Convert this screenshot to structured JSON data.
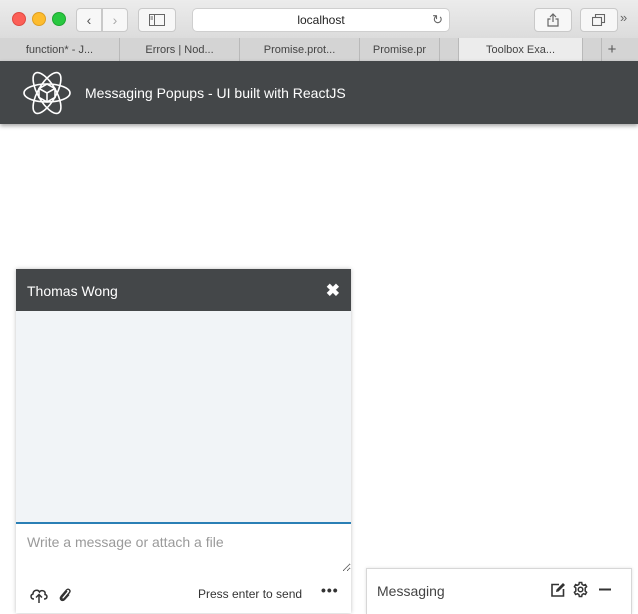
{
  "browser": {
    "url": "localhost",
    "tabs": [
      {
        "label": "function* - J..."
      },
      {
        "label": "Errors | Nod..."
      },
      {
        "label": "Promise.prot..."
      },
      {
        "label": "Promise.pr"
      },
      {
        "label": "Toolbox Exa..."
      }
    ],
    "nav": {
      "back": "‹",
      "forward": "›",
      "reload": "↻",
      "more": "»",
      "add_tab": "+"
    }
  },
  "app": {
    "title": "Messaging Popups - UI built with ReactJS",
    "header_color": "#444749",
    "accent": "#2a7fb5"
  },
  "chat": {
    "contact_name": "Thomas Wong",
    "close_glyph": "✖",
    "input_placeholder": "Write a message or attach a file",
    "input_value": "",
    "send_hint": "Press enter to send",
    "more_glyph": "•••"
  },
  "messaging_bar": {
    "title": "Messaging"
  }
}
